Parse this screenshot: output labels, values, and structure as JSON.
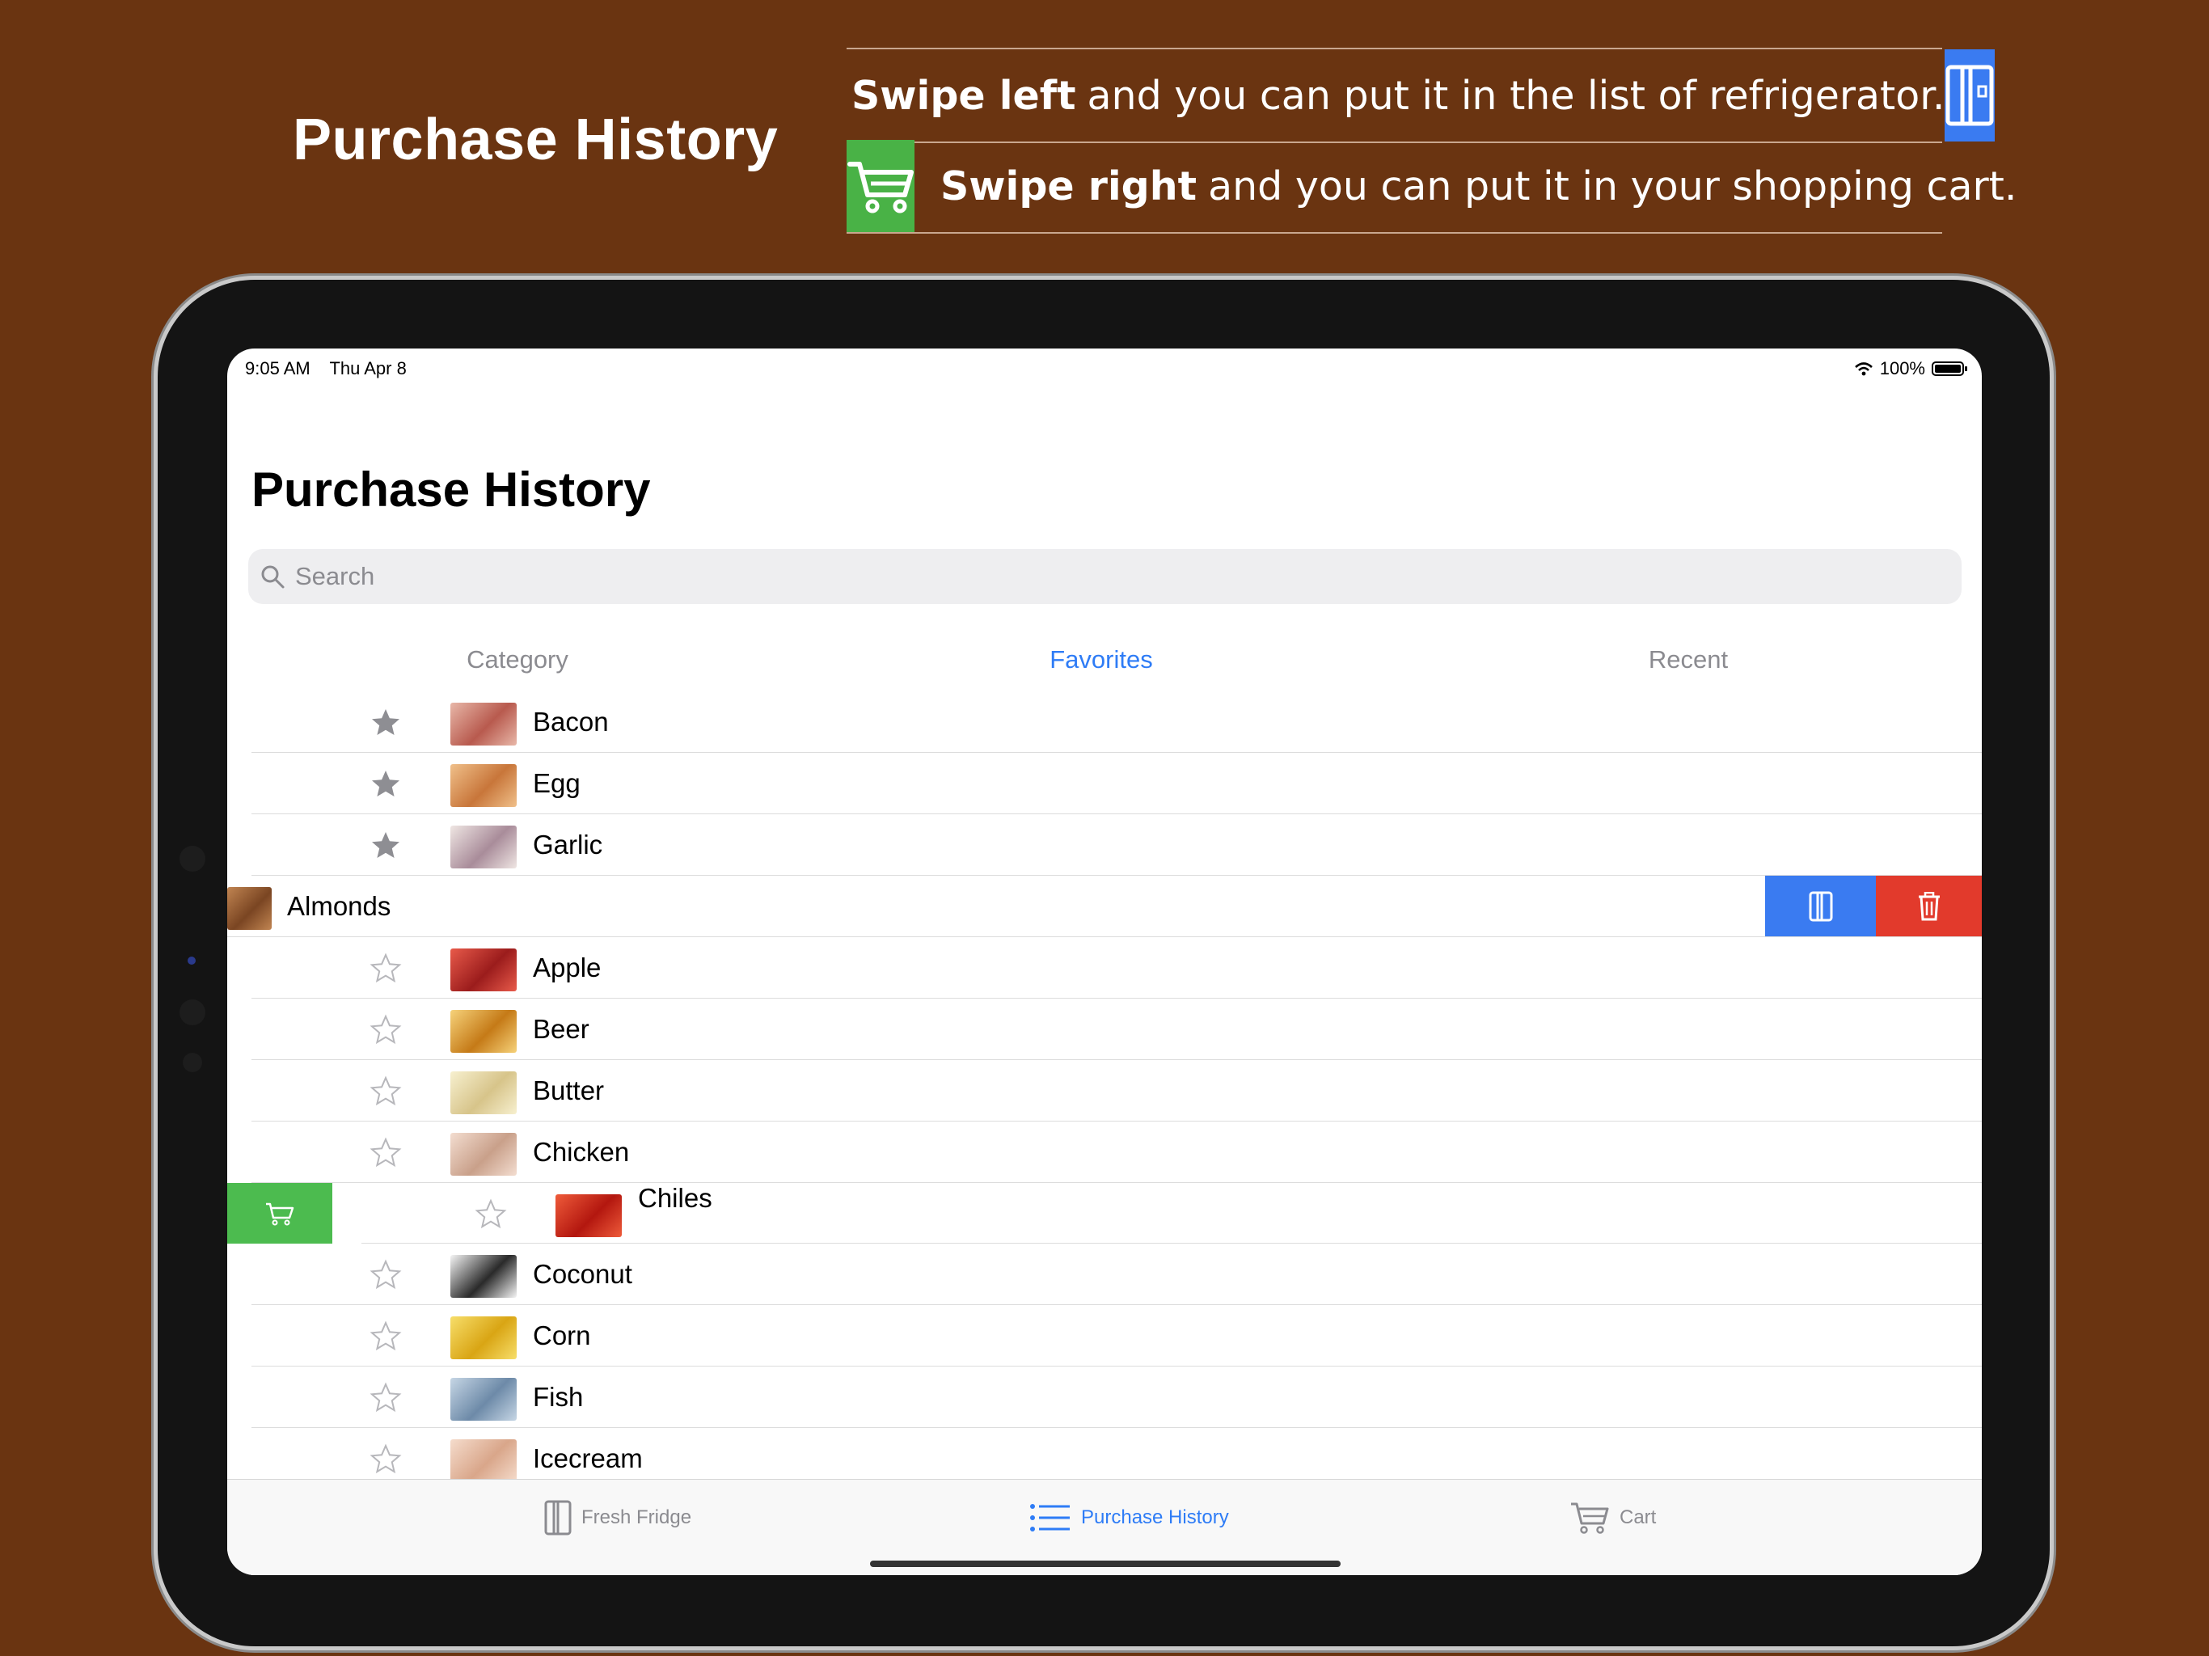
{
  "promo": {
    "title": "Purchase History",
    "tips": [
      {
        "bold": "Swipe left",
        "text": "and you can put it in the list of refrigerator.",
        "icon": "fridge-icon",
        "color": "#3a7bf1"
      },
      {
        "bold": "Swipe right",
        "text": "and you can put it in your shopping cart.",
        "icon": "cart-icon",
        "color": "#49b246"
      }
    ]
  },
  "status": {
    "time": "9:05 AM",
    "date": "Thu Apr 8",
    "battery": "100%"
  },
  "screen": {
    "title": "Purchase History",
    "search": {
      "placeholder": "Search",
      "value": ""
    },
    "segments": [
      "Category",
      "Favorites",
      "Recent"
    ],
    "active_segment": "Favorites"
  },
  "items": [
    {
      "name": "Bacon",
      "favorite": true
    },
    {
      "name": "Egg",
      "favorite": true
    },
    {
      "name": "Garlic",
      "favorite": true
    },
    {
      "name": "Almonds",
      "favorite": false,
      "state": "swiped-left"
    },
    {
      "name": "Apple",
      "favorite": false
    },
    {
      "name": "Beer",
      "favorite": false
    },
    {
      "name": "Butter",
      "favorite": false
    },
    {
      "name": "Chicken",
      "favorite": false
    },
    {
      "name": "Chiles",
      "favorite": false,
      "state": "swiped-right"
    },
    {
      "name": "Coconut",
      "favorite": false
    },
    {
      "name": "Corn",
      "favorite": false
    },
    {
      "name": "Fish",
      "favorite": false
    },
    {
      "name": "Icecream",
      "favorite": false
    }
  ],
  "tabbar": {
    "tabs": [
      {
        "label": "Fresh Fridge",
        "icon": "fridge-icon"
      },
      {
        "label": "Purchase History",
        "icon": "list-icon"
      },
      {
        "label": "Cart",
        "icon": "cart-icon"
      }
    ],
    "active": "Purchase History"
  },
  "colors": {
    "background": "#6a3411",
    "accent": "#2e7cf6",
    "fridge_action": "#3a7bf1",
    "trash_action": "#e23a2c",
    "cart_action": "#4cbb4f"
  }
}
